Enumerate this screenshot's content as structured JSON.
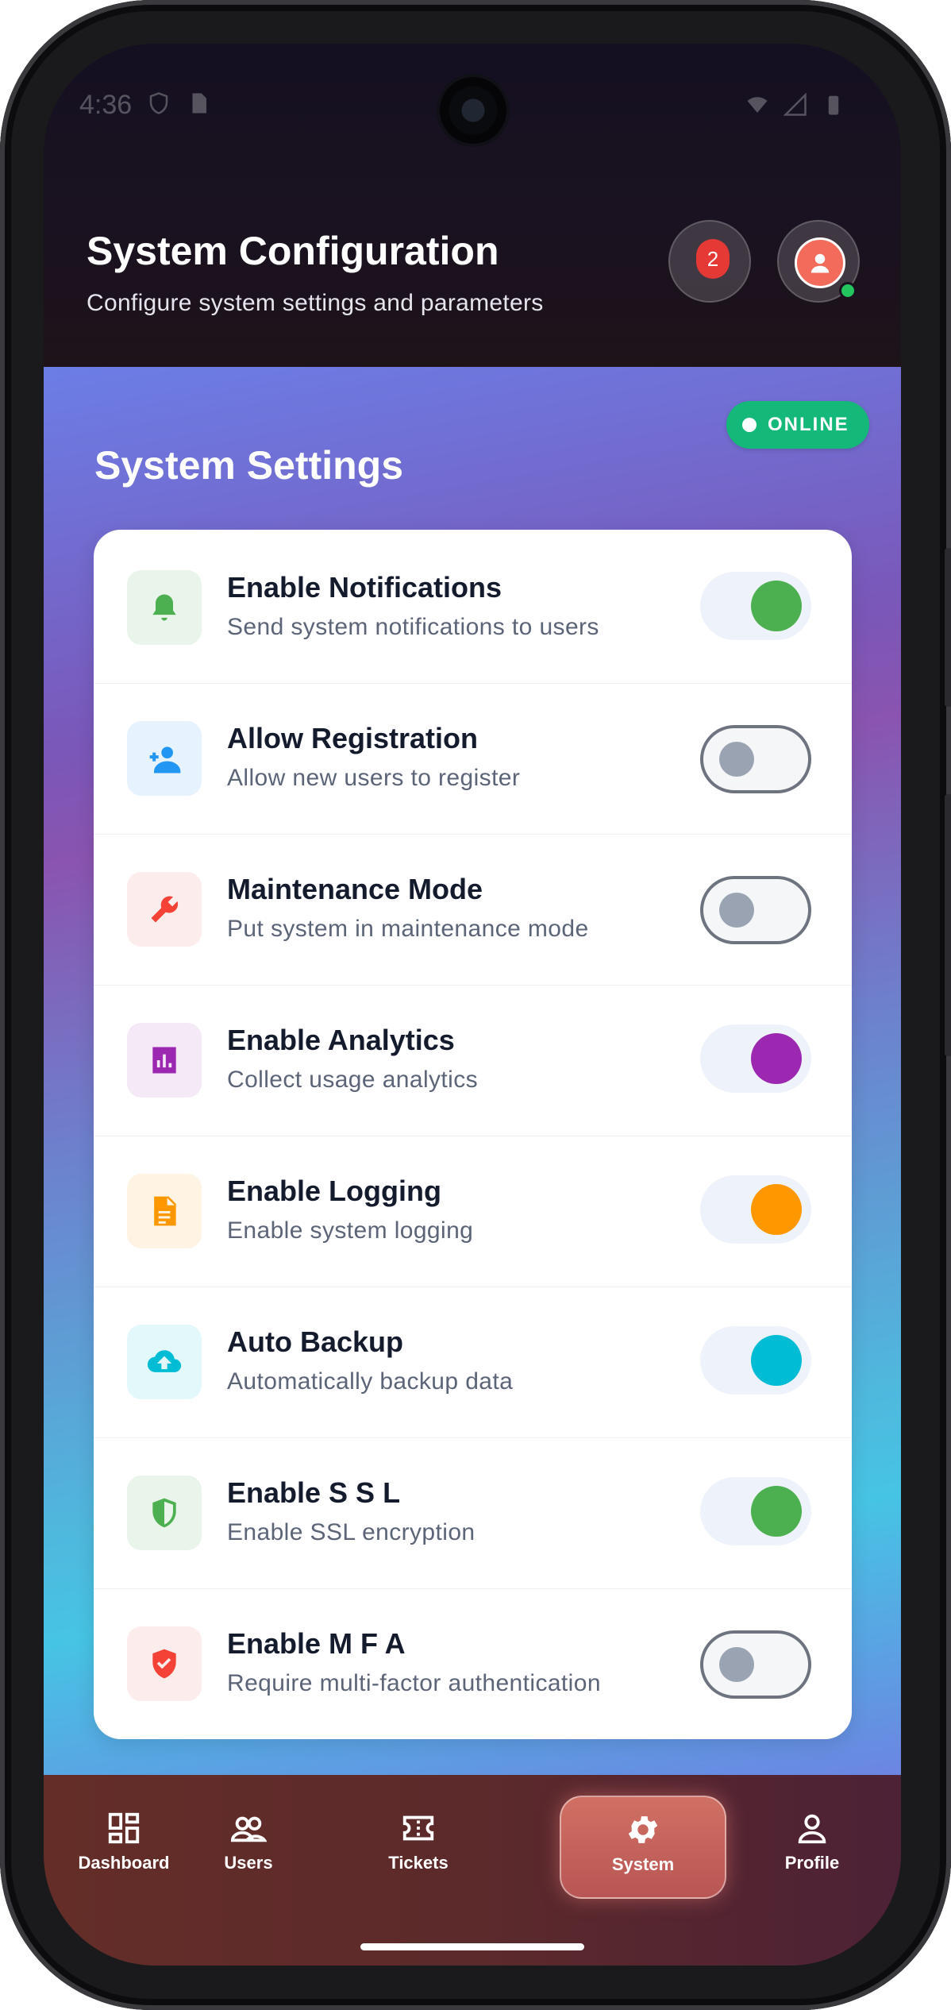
{
  "status_bar": {
    "time": "4:36"
  },
  "header": {
    "title": "System Configuration",
    "subtitle": "Configure system settings and parameters",
    "notification_count": "2"
  },
  "main": {
    "online_label": "ONLINE",
    "section_title": "System Settings",
    "settings": [
      {
        "title": "Enable Notifications",
        "subtitle": "Send system notifications to users",
        "enabled": true,
        "icon": "bell-icon",
        "color": "#4caf50",
        "tint": "#e9f5ea"
      },
      {
        "title": "Allow Registration",
        "subtitle": "Allow new users to register",
        "enabled": false,
        "icon": "person-add-icon",
        "color": "#2196f3",
        "tint": "#e6f2fd"
      },
      {
        "title": "Maintenance Mode",
        "subtitle": "Put system in maintenance mode",
        "enabled": false,
        "icon": "wrench-icon",
        "color": "#f44336",
        "tint": "#fdecec"
      },
      {
        "title": "Enable Analytics",
        "subtitle": "Collect usage analytics",
        "enabled": true,
        "icon": "analytics-icon",
        "color": "#9c27b0",
        "tint": "#f5e9f8"
      },
      {
        "title": "Enable Logging",
        "subtitle": "Enable system logging",
        "enabled": true,
        "icon": "document-icon",
        "color": "#ff9800",
        "tint": "#fff4e4"
      },
      {
        "title": "Auto Backup",
        "subtitle": "Automatically backup data",
        "enabled": true,
        "icon": "cloud-upload-icon",
        "color": "#00bcd4",
        "tint": "#e3f8fb"
      },
      {
        "title": "Enable S S L",
        "subtitle": "Enable SSL encryption",
        "enabled": true,
        "icon": "shield-icon",
        "color": "#4caf50",
        "tint": "#e9f5ea"
      },
      {
        "title": "Enable M F A",
        "subtitle": "Require multi-factor authentication",
        "enabled": false,
        "icon": "verified-user-icon",
        "color": "#f44336",
        "tint": "#fdecec"
      }
    ]
  },
  "nav": {
    "items": [
      {
        "label": "Dashboard",
        "icon": "dashboard-icon"
      },
      {
        "label": "Users",
        "icon": "users-icon"
      },
      {
        "label": "Tickets",
        "icon": "ticket-icon"
      },
      {
        "label": "System",
        "icon": "gear-icon",
        "active": true
      },
      {
        "label": "Profile",
        "icon": "profile-icon"
      }
    ]
  }
}
